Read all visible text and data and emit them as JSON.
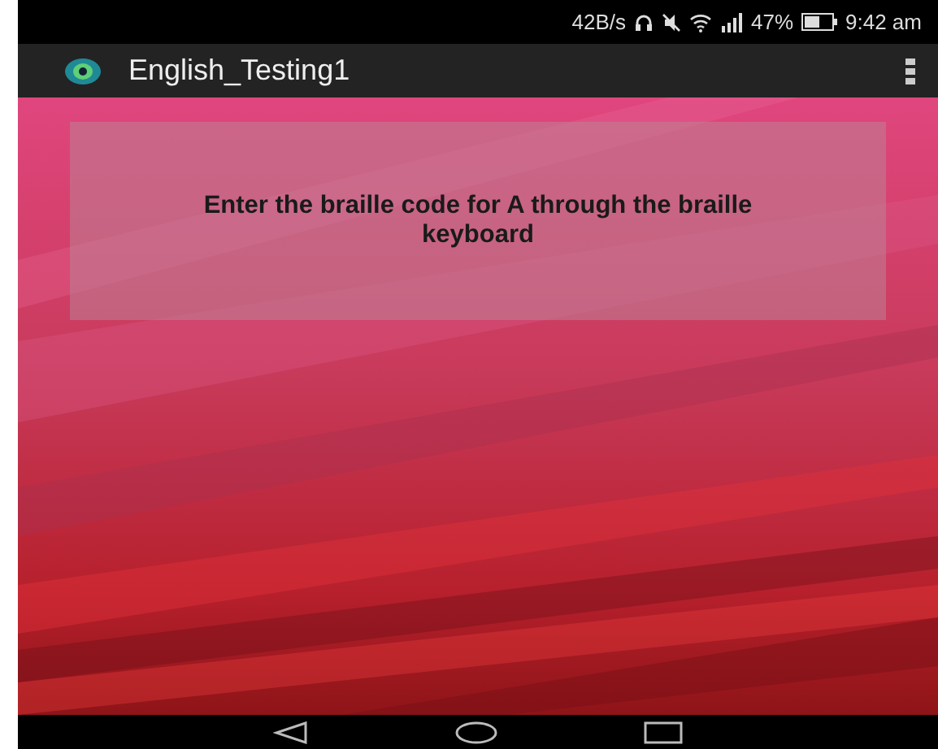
{
  "status_bar": {
    "speed": "42B/s",
    "battery": "47%",
    "time": "9:42 am"
  },
  "app_bar": {
    "title": "English_Testing1"
  },
  "prompt": {
    "text": "Enter the braille code for A through the braille keyboard"
  }
}
